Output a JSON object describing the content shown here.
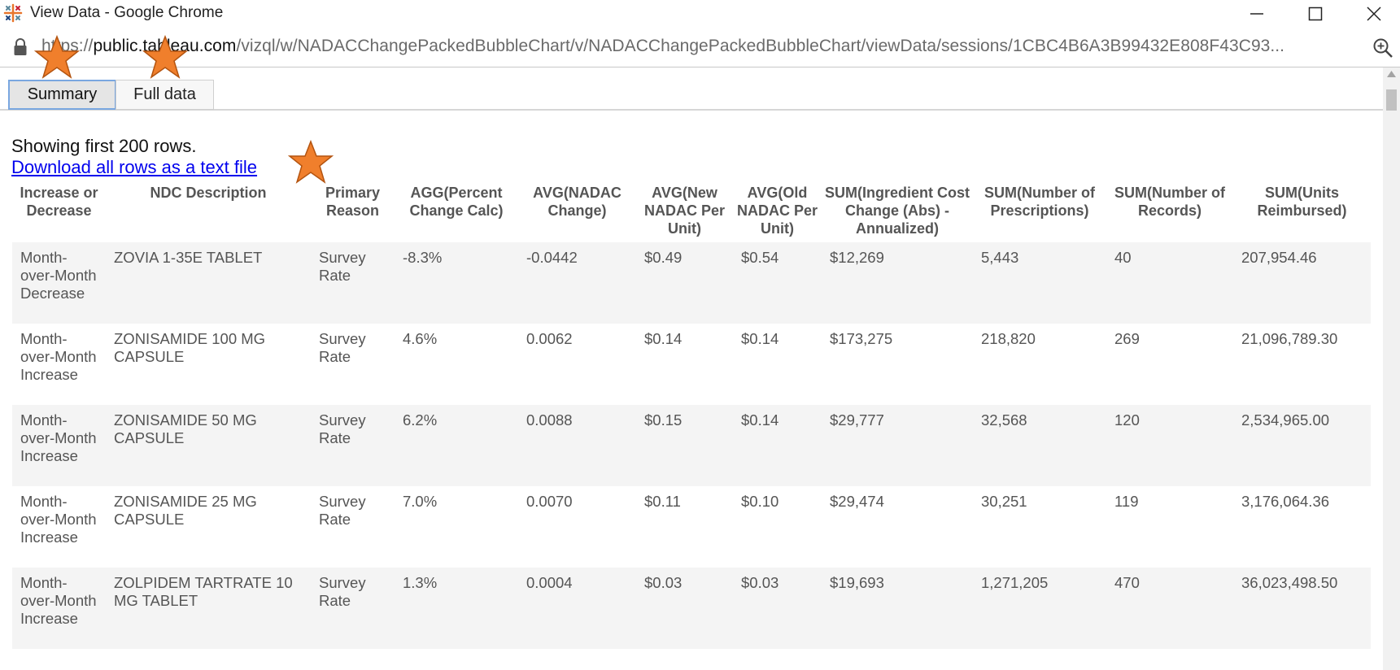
{
  "window": {
    "title": "View Data - Google Chrome",
    "app_icon": "tableau-logo-icon",
    "controls": [
      "minimize-icon",
      "maximize-icon",
      "close-icon"
    ]
  },
  "address_bar": {
    "url_prefix": "https://",
    "host": "public.tableau.com",
    "path": "/vizql/w/NADACChangePackedBubbleChart/v/NADACChangePackedBubbleChart/viewData/sessions/1CBC4B6A3B99432E808F43C93...",
    "lock_icon": "lock-icon",
    "zoom_icon": "zoom-icon"
  },
  "tabs": [
    {
      "label": "Summary",
      "active": true
    },
    {
      "label": "Full data",
      "active": false
    }
  ],
  "content": {
    "showing_text": "Showing first 200 rows.",
    "download_link": "Download all rows as a text file"
  },
  "table": {
    "headers": [
      "Increase or Decrease",
      "NDC Description",
      "Primary Reason",
      "AGG(Percent Change Calc)",
      "AVG(NADAC Change)",
      "AVG(New NADAC Per Unit)",
      "AVG(Old NADAC Per Unit)",
      "SUM(Ingredient Cost Change (Abs) - Annualized)",
      "SUM(Number of Prescriptions)",
      "SUM(Number of Records)",
      "SUM(Units Reimbursed)"
    ],
    "rows": [
      [
        "Month-over-Month Decrease",
        "ZOVIA 1-35E TABLET",
        "Survey Rate",
        "-8.3%",
        "-0.0442",
        "$0.49",
        "$0.54",
        "$12,269",
        "5,443",
        "40",
        "207,954.46"
      ],
      [
        "Month-over-Month Increase",
        "ZONISAMIDE 100 MG CAPSULE",
        "Survey Rate",
        "4.6%",
        "0.0062",
        "$0.14",
        "$0.14",
        "$173,275",
        "218,820",
        "269",
        "21,096,789.30"
      ],
      [
        "Month-over-Month Increase",
        "ZONISAMIDE 50 MG CAPSULE",
        "Survey Rate",
        "6.2%",
        "0.0088",
        "$0.15",
        "$0.14",
        "$29,777",
        "32,568",
        "120",
        "2,534,965.00"
      ],
      [
        "Month-over-Month Increase",
        "ZONISAMIDE 25 MG CAPSULE",
        "Survey Rate",
        "7.0%",
        "0.0070",
        "$0.11",
        "$0.10",
        "$29,474",
        "30,251",
        "119",
        "3,176,064.36"
      ],
      [
        "Month-over-Month Increase",
        "ZOLPIDEM TARTRATE 10 MG TABLET",
        "Survey Rate",
        "1.3%",
        "0.0004",
        "$0.03",
        "$0.03",
        "$19,693",
        "1,271,205",
        "470",
        "36,023,498.50"
      ]
    ]
  },
  "annotations": {
    "marker_icon": "star-marker-icon",
    "marker_color": "#f07f2c",
    "marker_stroke": "#b35410"
  },
  "colors": {
    "link": "#0000ee",
    "active_tab_border": "#7aa7e0",
    "row_stripe": "#f4f4f4"
  }
}
